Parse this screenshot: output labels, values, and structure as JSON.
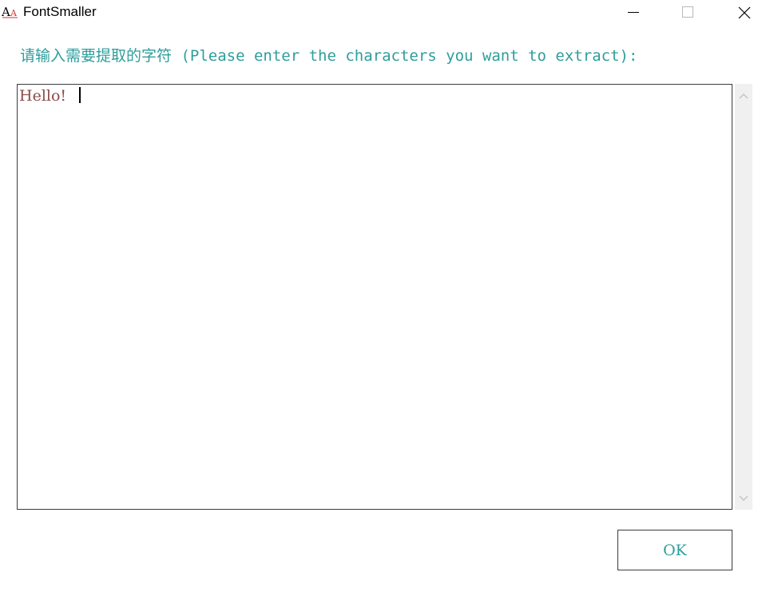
{
  "window": {
    "title": "FontSmaller",
    "icon": "font-aa-icon",
    "controls": {
      "minimize_icon": "minimize-icon",
      "maximize_icon": "maximize-icon",
      "close_icon": "close-icon"
    }
  },
  "main": {
    "prompt": "请输入需要提取的字符 (Please enter the characters you want to extract):",
    "input": {
      "value": "Hello!"
    },
    "ok_label": "OK"
  },
  "colors": {
    "accent": "#2e9e9c",
    "input_text": "#8b4a4a",
    "border": "#3c3c3c",
    "scrollbar_track": "#f0f0f0"
  }
}
